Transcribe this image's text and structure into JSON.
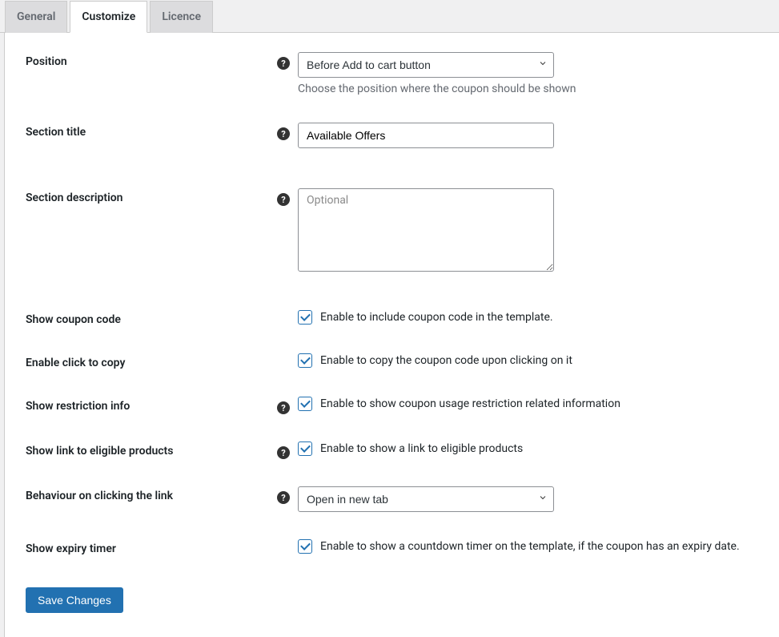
{
  "tabs": {
    "general": "General",
    "customize": "Customize",
    "licence": "Licence"
  },
  "fields": {
    "position": {
      "label": "Position",
      "selected": "Before Add to cart button",
      "description": "Choose the position where the coupon should be shown"
    },
    "section_title": {
      "label": "Section title",
      "value": "Available Offers"
    },
    "section_description": {
      "label": "Section description",
      "placeholder": "Optional"
    },
    "show_coupon_code": {
      "label": "Show coupon code",
      "desc": "Enable to include coupon code in the template."
    },
    "enable_click_to_copy": {
      "label": "Enable click to copy",
      "desc": "Enable to copy the coupon code upon clicking on it"
    },
    "show_restriction_info": {
      "label": "Show restriction info",
      "desc": "Enable to show coupon usage restriction related information"
    },
    "show_link_eligible": {
      "label": "Show link to eligible products",
      "desc": "Enable to show a link to eligible products"
    },
    "behaviour_link": {
      "label": "Behaviour on clicking the link",
      "selected": "Open in new tab"
    },
    "show_expiry_timer": {
      "label": "Show expiry timer",
      "desc": "Enable to show a countdown timer on the template, if the coupon has an expiry date."
    }
  },
  "buttons": {
    "save": "Save Changes"
  }
}
